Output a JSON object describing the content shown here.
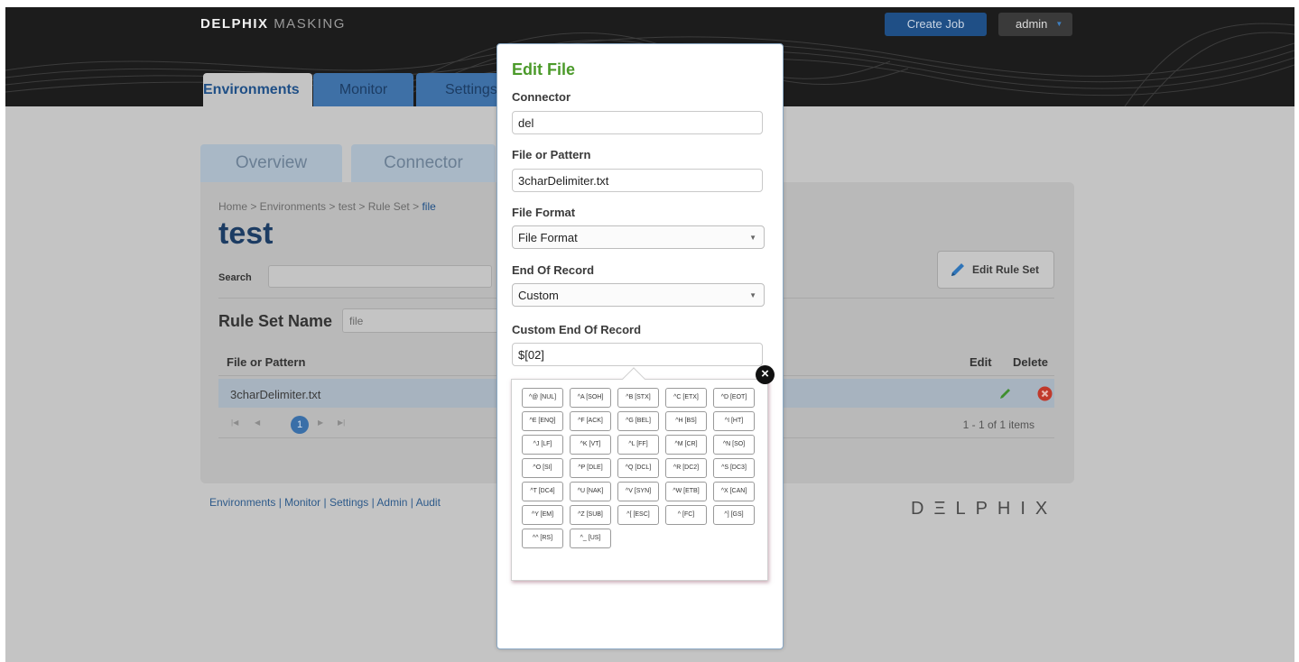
{
  "header": {
    "brand_bold": "DELPHIX",
    "brand_light": "MASKING",
    "create_job": "Create Job",
    "user": "admin"
  },
  "main_tabs": [
    "Environments",
    "Monitor",
    "Settings"
  ],
  "sub_tabs": [
    "Overview",
    "Connector"
  ],
  "panel": {
    "breadcrumb": "Home > Environments > test > Rule Set > ",
    "breadcrumb_current": "file",
    "title": "test",
    "search_label": "Search",
    "edit_rule_set": "Edit Rule Set",
    "rule_set_name_label": "Rule Set Name",
    "rule_set_name_value": "file",
    "columns": {
      "file_or_pattern": "File or Pattern",
      "edit": "Edit",
      "delete": "Delete"
    },
    "rows": [
      {
        "file": "3charDelimiter.txt"
      }
    ],
    "pager": {
      "current_page": "1",
      "info": "1 - 1 of 1 items"
    }
  },
  "footer": {
    "links": "Environments | Monitor | Settings | Admin | Audit",
    "logo": "DΞLPHIX"
  },
  "modal": {
    "title": "Edit File",
    "connector_label": "Connector",
    "connector_value": "del",
    "file_label": "File or Pattern",
    "file_value": "3charDelimiter.txt",
    "format_label": "File Format",
    "format_value": "File Format",
    "eor_label": "End Of Record",
    "eor_value": "Custom",
    "custom_eor_label": "Custom End Of Record",
    "custom_eor_value": "$[02]"
  },
  "control_chars": [
    "^@ [NUL]",
    "^A [SOH]",
    "^B [STX]",
    "^C [ETX]",
    "^D [EOT]",
    "^E [ENQ]",
    "^F [ACK]",
    "^G [BEL]",
    "^H [BS]",
    "^I [HT]",
    "^J [LF]",
    "^K [VT]",
    "^L [FF]",
    "^M [CR]",
    "^N [SO]",
    "^O [SI]",
    "^P [DLE]",
    "^Q [DCL]",
    "^R [DC2]",
    "^S [DC3]",
    "^T [DC4]",
    "^U [NAK]",
    "^V [SYN]",
    "^W [ETB]",
    "^X [CAN]",
    "^Y [EM]",
    "^Z [SUB]",
    "^[ [ESC]",
    "^ [FC]",
    "^] [GS]",
    "^^ [RS]",
    "^_ [US]"
  ],
  "colors": {
    "brand_blue": "#1f4f86",
    "modal_title_green": "#4b9a2a",
    "edit_green": "#3f8f2f",
    "delete_red": "#c0392b"
  }
}
